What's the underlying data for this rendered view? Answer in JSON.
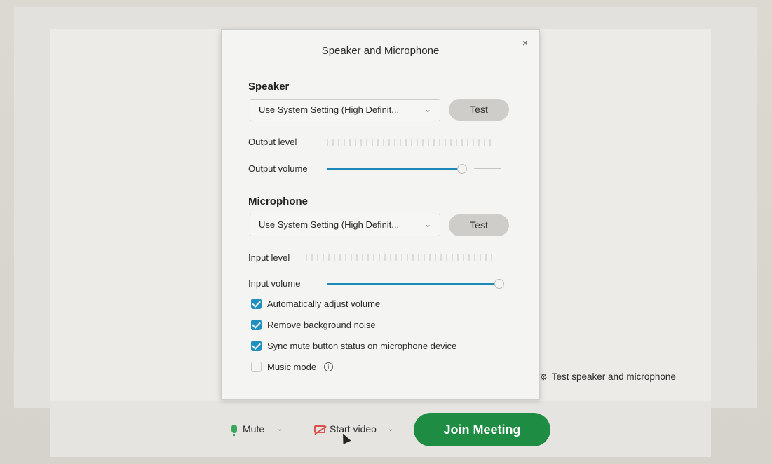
{
  "dialog": {
    "title": "Speaker and Microphone",
    "close_label": "×",
    "speaker": {
      "heading": "Speaker",
      "device": "Use System Setting (High Definit...",
      "test_label": "Test",
      "output_level_label": "Output level",
      "output_volume_label": "Output volume",
      "output_volume_value": 0.9
    },
    "microphone": {
      "heading": "Microphone",
      "device": "Use System Setting (High Definit...",
      "test_label": "Test",
      "input_level_label": "Input level",
      "input_volume_label": "Input volume",
      "input_volume_value": 1.0
    },
    "options": [
      {
        "label": "Automatically adjust volume",
        "checked": true
      },
      {
        "label": "Remove background noise",
        "checked": true
      },
      {
        "label": "Sync mute button status on microphone device",
        "checked": true
      },
      {
        "label": "Music mode",
        "checked": false
      }
    ]
  },
  "test_link": "Test speaker and microphone",
  "toolbar": {
    "mute_label": "Mute",
    "video_label": "Start video",
    "join_label": "Join Meeting"
  },
  "colors": {
    "accent": "#1f8fbf",
    "join_green": "#1e8d43",
    "mic_green": "#3aa55c",
    "camera_red": "#d9534f"
  }
}
